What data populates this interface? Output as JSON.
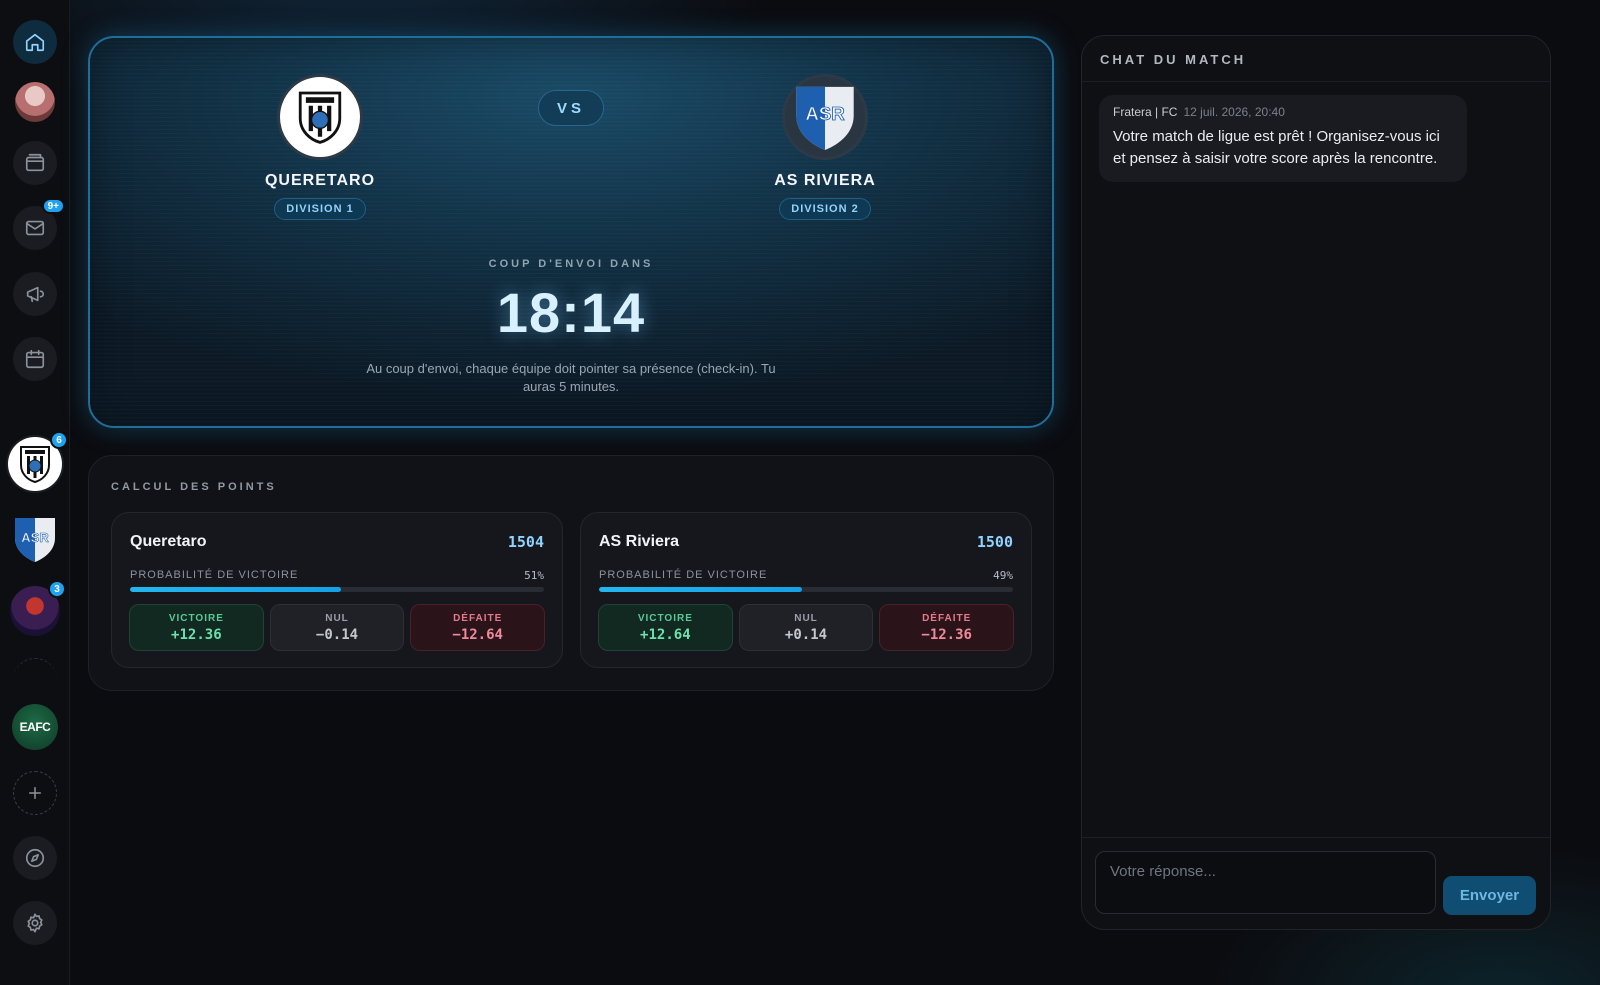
{
  "theme": {
    "accent": "#1fa3f0",
    "win": "#6ee0ad",
    "loss": "#f08a9b",
    "background": "#0b0c10"
  },
  "sidebar": {
    "items": [
      {
        "name": "home",
        "icon": "home-icon",
        "active": true
      },
      {
        "name": "profile",
        "icon": "avatar"
      },
      {
        "name": "wallet",
        "icon": "wallet-icon"
      },
      {
        "name": "messages",
        "icon": "mail-icon",
        "badge": "9+"
      },
      {
        "name": "announcements",
        "icon": "megaphone-icon"
      },
      {
        "name": "calendar",
        "icon": "calendar-icon"
      }
    ],
    "clubs": [
      {
        "name": "queretaro",
        "badge": "6"
      },
      {
        "name": "as-riviera",
        "logo_text": "ASR"
      },
      {
        "name": "game-community",
        "badge": "3"
      },
      {
        "name": "eafc",
        "logo_text": "EAFC"
      }
    ],
    "bottom": [
      {
        "name": "add",
        "icon": "plus-icon"
      },
      {
        "name": "explore",
        "icon": "compass-icon"
      },
      {
        "name": "settings",
        "icon": "gear-icon"
      }
    ]
  },
  "match": {
    "vs_label": "VS",
    "home": {
      "name": "QUERETARO",
      "division": "DIVISION 1"
    },
    "away": {
      "name": "AS RIVIERA",
      "division": "DIVISION 2",
      "logo_text": "ASR"
    },
    "kickoff_label": "COUP D'ENVOI DANS",
    "countdown": "18:14",
    "note": "Au coup d'envoi, chaque équipe doit pointer sa présence (check-in). Tu auras 5 minutes."
  },
  "points": {
    "title": "CALCUL DES POINTS",
    "teams": [
      {
        "name": "Queretaro",
        "rating": "1504",
        "prob_label": "PROBABILITÉ DE VICTOIRE",
        "prob": 51,
        "prob_text": "51%",
        "outcomes": {
          "win_label": "VICTOIRE",
          "win": "+12.36",
          "draw_label": "NUL",
          "draw": "−0.14",
          "loss_label": "DÉFAITE",
          "loss": "−12.64"
        }
      },
      {
        "name": "AS Riviera",
        "rating": "1500",
        "prob_label": "PROBABILITÉ DE VICTOIRE",
        "prob": 49,
        "prob_text": "49%",
        "outcomes": {
          "win_label": "VICTOIRE",
          "win": "+12.64",
          "draw_label": "NUL",
          "draw": "+0.14",
          "loss_label": "DÉFAITE",
          "loss": "−12.36"
        }
      }
    ]
  },
  "chat": {
    "title": "CHAT DU MATCH",
    "messages": [
      {
        "author": "Fratera | FC",
        "time": "12 juil. 2026, 20:40",
        "text": "Votre match de ligue est prêt ! Organisez-vous ici et pensez à saisir votre score après la rencontre."
      }
    ],
    "input_placeholder": "Votre réponse...",
    "send_label": "Envoyer"
  }
}
